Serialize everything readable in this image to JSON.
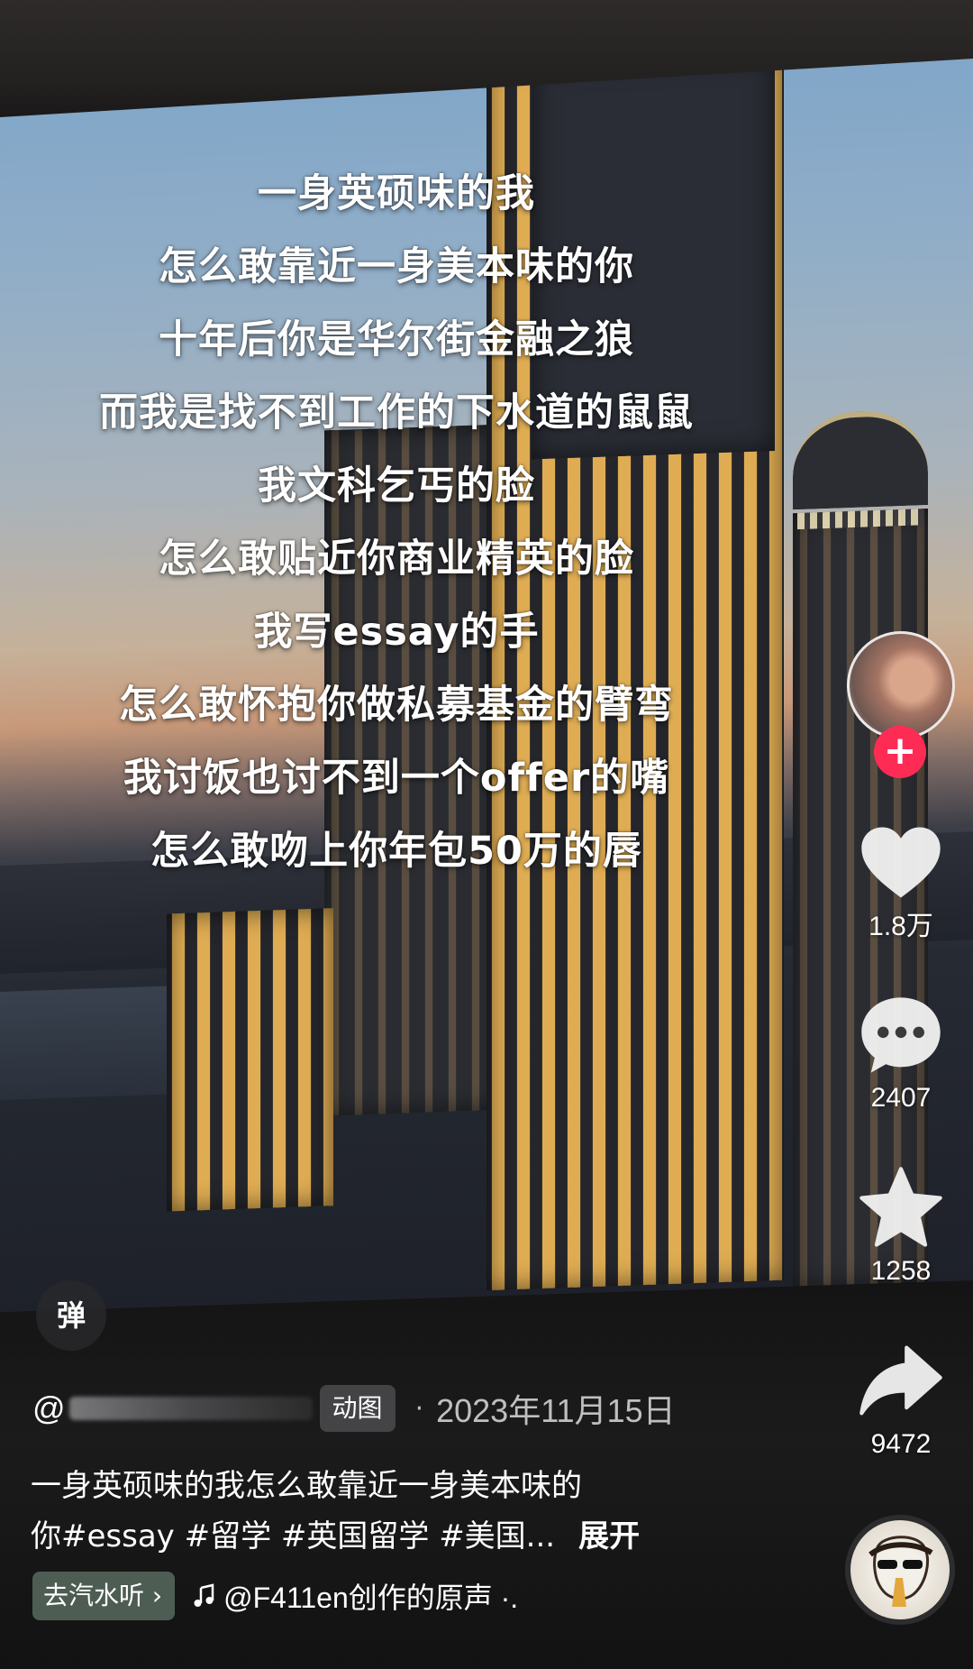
{
  "lyrics": [
    "一身英硕味的我",
    "怎么敢靠近一身美本味的你",
    "十年后你是华尔街金融之狼",
    "而我是找不到工作的下水道的鼠鼠",
    "我文科乞丐的脸",
    "怎么敢贴近你商业精英的脸",
    "我写essay的手",
    "怎么敢怀抱你做私募基金的臂弯",
    "我讨饭也讨不到一个offer的嘴",
    "怎么敢吻上你年包50万的唇"
  ],
  "actions": {
    "follow_symbol": "+",
    "like_count": "1.8万",
    "comment_count": "2407",
    "favorite_count": "1258",
    "share_count": "9472"
  },
  "danmu_label": "弹",
  "author": {
    "at": "@",
    "gif_badge": "动图",
    "separator": "·",
    "date": "2023年11月15日"
  },
  "caption": {
    "line1": "一身英硕味的我怎么敢靠近一身美本味的",
    "line2": "你#essay #留学 #英国留学 #美国...",
    "expand": "展开"
  },
  "music": {
    "qishui_label": "去汽水听 ›",
    "text": "@F411en创作的原声 ·."
  },
  "colors": {
    "follow_red": "#fe2c55",
    "qishui_chip": "#627668"
  }
}
